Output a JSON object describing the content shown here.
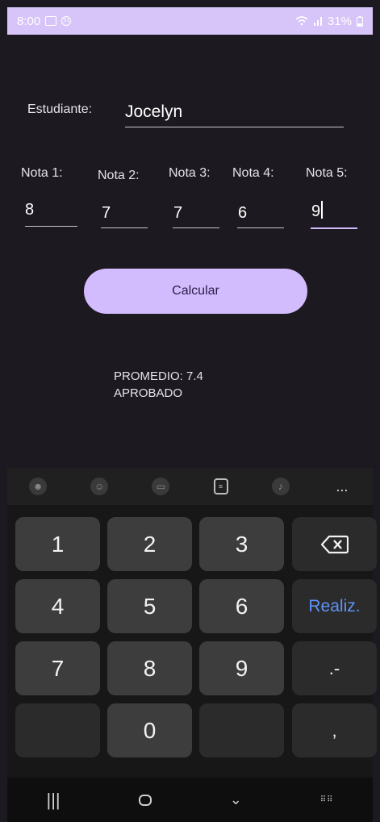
{
  "status_bar": {
    "time": "8:00",
    "battery": "31%",
    "left_icons": [
      "image-notification-icon",
      "calendar-icon"
    ],
    "right_icons": [
      "wifi-icon",
      "signal-icon",
      "battery-icon"
    ]
  },
  "form": {
    "student_label": "Estudiante:",
    "student_value": "Jocelyn",
    "grades": [
      {
        "label": "Nota 1:",
        "value": "8"
      },
      {
        "label": "Nota 2:",
        "value": "7"
      },
      {
        "label": "Nota 3:",
        "value": "7"
      },
      {
        "label": "Nota 4:",
        "value": "6"
      },
      {
        "label": "Nota 5:",
        "value": "9"
      }
    ],
    "calculate_label": "Calcular",
    "result_average": "PROMEDIO: 7.4",
    "result_status": "APROBADO"
  },
  "keyboard": {
    "tools": [
      "sticker-icon",
      "emoji-icon",
      "gif-icon",
      "clipboard-icon",
      "microphone-icon",
      "more-icon"
    ],
    "more_label": "...",
    "keys": {
      "k1": "1",
      "k2": "2",
      "k3": "3",
      "k4": "4",
      "k5": "5",
      "k6": "6",
      "k7": "7",
      "k8": "8",
      "k9": "9",
      "k0": "0",
      "done": "Realiz.",
      "dot_dash": ".-",
      "comma": ","
    }
  },
  "colors": {
    "accent": "#d3bcfd",
    "status_bar": "#d7c4f8",
    "background": "#1c1a20",
    "done_key_text": "#5e93f6"
  }
}
